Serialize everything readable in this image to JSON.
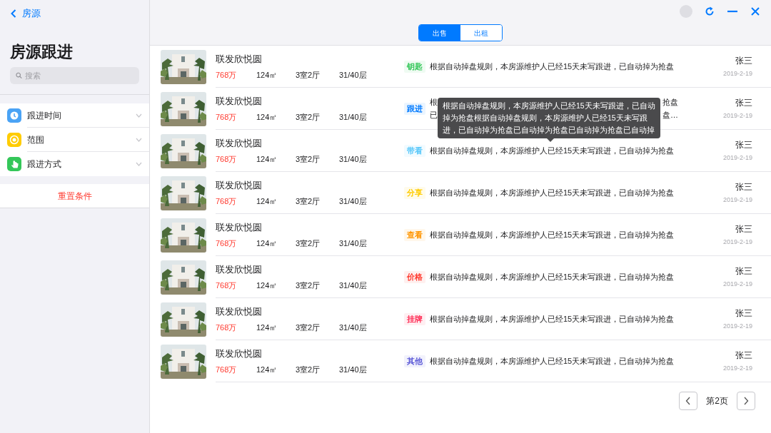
{
  "sidebar": {
    "back_label": "房源",
    "title": "房源跟进",
    "search": {
      "placeholder": "搜索"
    },
    "filters": [
      {
        "kind": "clock",
        "label": "跟进时间",
        "expanded": false
      },
      {
        "kind": "target",
        "label": "范围",
        "expanded": false
      },
      {
        "kind": "hand",
        "label": "跟进方式",
        "expanded": false
      }
    ],
    "reset_label": "重置条件"
  },
  "tabs": [
    {
      "label": "出售",
      "selected": true
    },
    {
      "label": "出租",
      "selected": false
    }
  ],
  "listings": [
    {
      "title": "联发欣悦圆",
      "price": "768万",
      "area": "124㎡",
      "layout": "3室2厅",
      "floor": "31/40层",
      "tag": "钥匙",
      "color": "#34c759",
      "note": "根据自动掉盘规则，本房源维护人已经15天未写跟进，已自动掉为抢盘",
      "agent": "张三",
      "date": "2019-2-19"
    },
    {
      "title": "联发欣悦圆",
      "price": "768万",
      "area": "124㎡",
      "layout": "3室2厅",
      "floor": "31/40层",
      "tag": "跟进",
      "color": "#007aff",
      "note_lines": [
        [
          "根",
          "抢盘"
        ],
        [
          "已",
          "盘…"
        ]
      ],
      "agent": "张三",
      "date": "2019-2-19"
    },
    {
      "title": "联发欣悦圆",
      "price": "768万",
      "area": "124㎡",
      "layout": "3室2厅",
      "floor": "31/40层",
      "tag": "带看",
      "color": "#5ac8fa",
      "note": "根据自动掉盘规则，本房源维护人已经15天未写跟进，已自动掉为抢盘",
      "agent": "张三",
      "date": "2019-2-19"
    },
    {
      "title": "联发欣悦圆",
      "price": "768万",
      "area": "124㎡",
      "layout": "3室2厅",
      "floor": "31/40层",
      "tag": "分享",
      "color": "#ffcc00",
      "note": "根据自动掉盘规则，本房源维护人已经15天未写跟进，已自动掉为抢盘",
      "agent": "张三",
      "date": "2019-2-19"
    },
    {
      "title": "联发欣悦圆",
      "price": "768万",
      "area": "124㎡",
      "layout": "3室2厅",
      "floor": "31/40层",
      "tag": "查看",
      "color": "#ff9500",
      "note": "根据自动掉盘规则，本房源维护人已经15天未写跟进，已自动掉为抢盘",
      "agent": "张三",
      "date": "2019-2-19"
    },
    {
      "title": "联发欣悦圆",
      "price": "768万",
      "area": "124㎡",
      "layout": "3室2厅",
      "floor": "31/40层",
      "tag": "价格",
      "color": "#ff3b30",
      "note": "根据自动掉盘规则，本房源维护人已经15天未写跟进，已自动掉为抢盘",
      "agent": "张三",
      "date": "2019-2-19"
    },
    {
      "title": "联发欣悦圆",
      "price": "768万",
      "area": "124㎡",
      "layout": "3室2厅",
      "floor": "31/40层",
      "tag": "挂牌",
      "color": "#ff2d55",
      "note": "根据自动掉盘规则，本房源维护人已经15天未写跟进，已自动掉为抢盘",
      "agent": "张三",
      "date": "2019-2-19"
    },
    {
      "title": "联发欣悦圆",
      "price": "768万",
      "area": "124㎡",
      "layout": "3室2厅",
      "floor": "31/40层",
      "tag": "其他",
      "color": "#5856d6",
      "note": "根据自动掉盘规则，本房源维护人已经15天未写跟进，已自动掉为抢盘",
      "agent": "张三",
      "date": "2019-2-19"
    }
  ],
  "tooltip": "根据自动掉盘规则，本房源维护人已经15天未写跟进，已自动掉为抢盘根据自动掉盘规则，本房源维护人已经15天未写跟进，已自动掉为抢盘已自动掉为抢盘已自动掉为抢盘已自动掉",
  "pagination": {
    "page_label": "第2页"
  }
}
